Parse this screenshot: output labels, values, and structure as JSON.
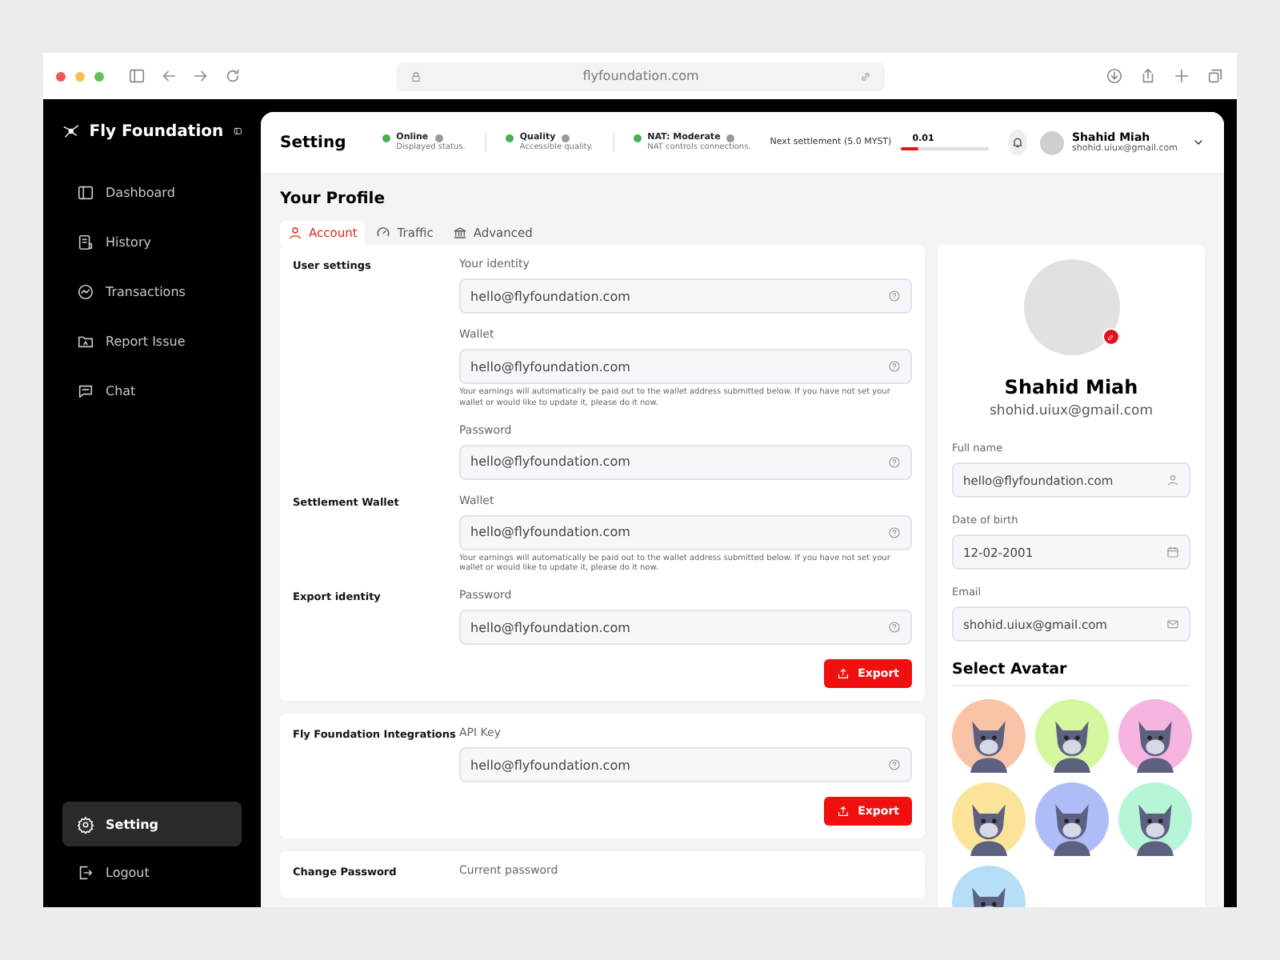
{
  "browser": {
    "url": "flyfoundation.com"
  },
  "sidebar": {
    "brand": "Fly Foundation",
    "items": [
      {
        "label": "Dashboard",
        "selected": false
      },
      {
        "label": "History",
        "selected": false
      },
      {
        "label": "Transactions",
        "selected": false
      },
      {
        "label": "Report Issue",
        "selected": false
      },
      {
        "label": "Chat",
        "selected": false
      }
    ],
    "bottom_items": [
      {
        "label": "Setting",
        "selected": true
      },
      {
        "label": "Logout",
        "selected": false
      }
    ]
  },
  "header": {
    "title": "Setting",
    "statuses": [
      {
        "label": "Online",
        "caption": "Displayed status.",
        "color": "#4caf50"
      },
      {
        "label": "Quality",
        "caption": "Accessible quality.",
        "color": "#4caf50"
      },
      {
        "label": "NAT: Moderate",
        "caption": "NAT controls connections.",
        "color": "#4caf50"
      }
    ],
    "settlement": {
      "label": "Next settlement (5.0 MYST)",
      "reading": "0.01",
      "level": 0.2
    },
    "user": {
      "name": "Shahid Miah",
      "email": "shohid.uiux@gmail.com"
    }
  },
  "page_title": "Your Profile",
  "tabs": [
    {
      "label": "Account",
      "selected": true
    },
    {
      "label": "Traffic",
      "selected": false
    },
    {
      "label": "Advanced",
      "selected": false
    }
  ],
  "cards": [
    {
      "groups": [
        {
          "title": "User settings",
          "fields": [
            {
              "label": "Your identity",
              "value": "hello@flyfoundation.com"
            },
            {
              "label": "Wallet",
              "value": "hello@flyfoundation.com",
              "note": "Your earnings will automatically be paid out to the wallet address submitted below. If you have not set your wallet or would like to update it, please do it now."
            },
            {
              "label": "Password",
              "value": "hello@flyfoundation.com"
            }
          ]
        },
        {
          "title": "Settlement Wallet",
          "fields": [
            {
              "label": "Wallet",
              "value": "hello@flyfoundation.com",
              "note": "Your earnings will automatically be paid out to the wallet address submitted below. If you have not set your wallet or would like to update it, please do it now."
            }
          ]
        },
        {
          "title": "Export identity",
          "fields": [
            {
              "label": "Password",
              "value": "hello@flyfoundation.com"
            }
          ]
        }
      ],
      "button": "Export"
    },
    {
      "groups": [
        {
          "title": "Fly Foundation Integrations",
          "fields": [
            {
              "label": "API Key",
              "value": "hello@flyfoundation.com"
            }
          ]
        }
      ],
      "button": "Export"
    },
    {
      "groups": [
        {
          "title": "Change Password",
          "fields": [
            {
              "label": "Current password"
            }
          ]
        }
      ]
    }
  ],
  "profile": {
    "name": "Shahid Miah",
    "email": "shohid.uiux@gmail.com",
    "fields": [
      {
        "label": "Full name",
        "value": "hello@flyfoundation.com"
      },
      {
        "label": "Date of birth",
        "value": "12-02-2001"
      },
      {
        "label": "Email",
        "value": "shohid.uiux@gmail.com"
      }
    ],
    "avatar_title": "Select Avatar",
    "avatars": [
      {
        "color": "#f9c3a7"
      },
      {
        "color": "#d4f7a0"
      },
      {
        "color": "#f6b4e0"
      },
      {
        "color": "#fbe39a"
      },
      {
        "color": "#aebcf7"
      },
      {
        "color": "#b6f5d8"
      },
      {
        "color": "#b7def7"
      }
    ]
  }
}
